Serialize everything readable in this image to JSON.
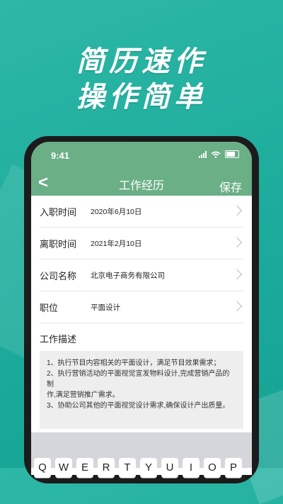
{
  "promo": {
    "line1": "简历速作",
    "line2": "操作简单"
  },
  "status": {
    "time": "9:41"
  },
  "nav": {
    "back": "<",
    "title": "工作经历",
    "save": "保存"
  },
  "form": {
    "rows": [
      {
        "label": "入职时间",
        "value": "2020年6月10日"
      },
      {
        "label": "离职时间",
        "value": "2021年2月10日"
      },
      {
        "label": "公司名称",
        "value": "北京电子商务有限公司"
      },
      {
        "label": "职位",
        "value": "平面设计"
      }
    ],
    "description_label": "工作描述",
    "description_lines": [
      "1、执行节目内容相关的平面设计，满足节目效果需求；",
      "2、执行营销活动的平面视觉宣发物料设计,完成营销产品的制",
      "作,满足营销推广需求。",
      "3、协助公司其他的平面视觉设计需求,确保设计产出质量。"
    ]
  },
  "keyboard": {
    "keys": [
      "Q",
      "W",
      "E",
      "R",
      "T",
      "Y",
      "U",
      "I",
      "O",
      "P"
    ]
  },
  "colors": {
    "background": "#1fae9d",
    "header": "#6aaf86",
    "text": "#222222"
  }
}
